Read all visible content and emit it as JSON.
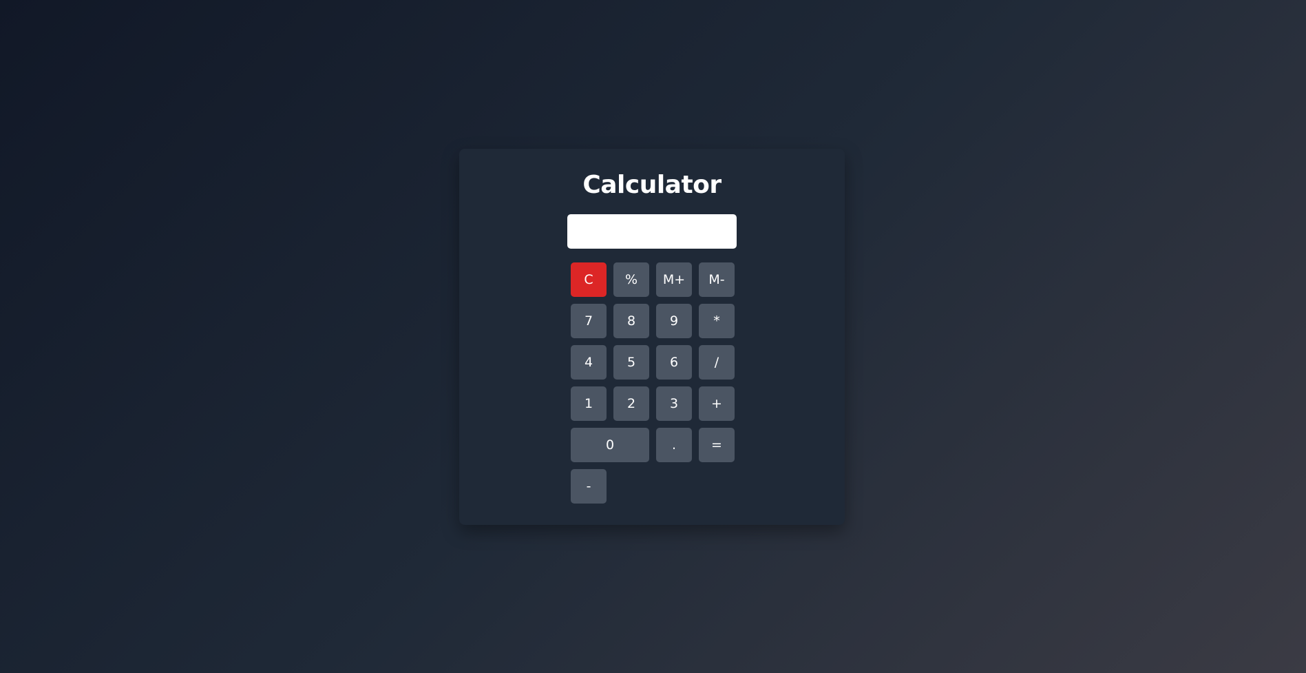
{
  "app": {
    "title": "Calculator"
  },
  "display": {
    "value": "",
    "placeholder": ""
  },
  "keys": {
    "clear": "C",
    "percent": "%",
    "mem_plus": "M+",
    "mem_minus": "M-",
    "seven": "7",
    "eight": "8",
    "nine": "9",
    "multiply": "*",
    "four": "4",
    "five": "5",
    "six": "6",
    "divide": "/",
    "one": "1",
    "two": "2",
    "three": "3",
    "plus": "+",
    "zero": "0",
    "decimal": ".",
    "equals": "=",
    "minus": "-"
  },
  "colors": {
    "clear_button": "#dc2626",
    "key_button": "#4b5563",
    "card_background": "#1f2937",
    "display_background": "#ffffff"
  }
}
